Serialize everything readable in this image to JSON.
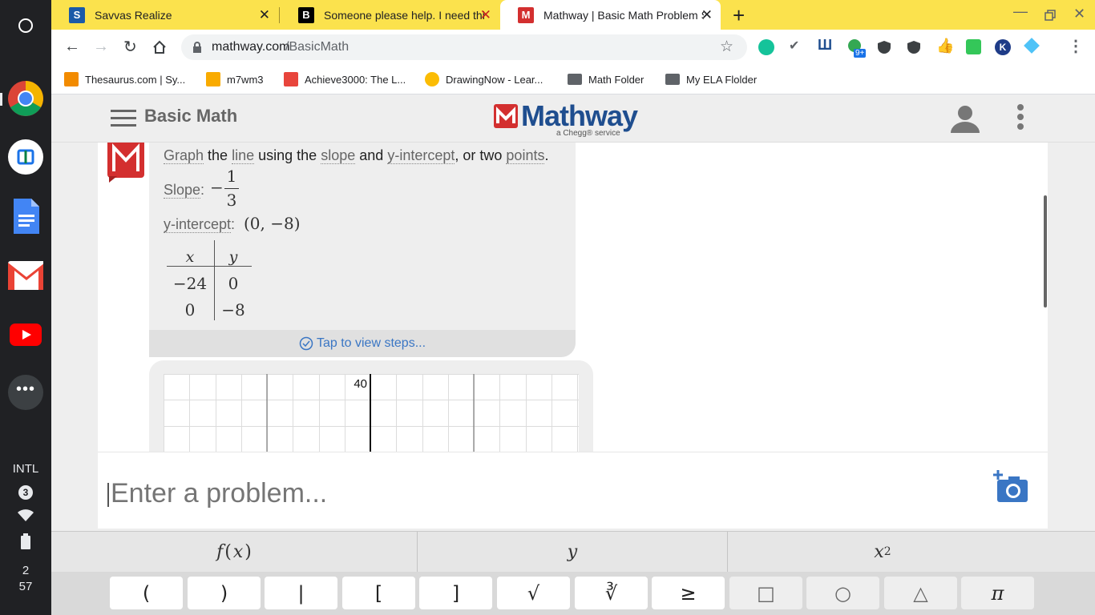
{
  "shelf": {
    "intl": "INTL",
    "notification_count": "3",
    "time_hour": "2",
    "time_minute": "57"
  },
  "tabs": [
    {
      "title": "Savvas Realize",
      "favicon": "S"
    },
    {
      "title": "Someone please help. I need this",
      "favicon": "B"
    },
    {
      "title": "Mathway | Basic Math Problem Solver",
      "favicon": "M"
    }
  ],
  "address": {
    "domain": "mathway.com",
    "path": "/BasicMath"
  },
  "extensions_badge": "9+",
  "ext_k": "K",
  "bookmarks": [
    {
      "label": "Thesaurus.com | Sy..."
    },
    {
      "label": "m7wm3"
    },
    {
      "label": "Achieve3000: The L..."
    },
    {
      "label": "DrawingNow - Lear..."
    },
    {
      "label": "Math Folder"
    },
    {
      "label": "My ELA Flolder"
    }
  ],
  "header": {
    "section": "Basic Math",
    "logo": "Mathway",
    "tagline": "a Chegg® service"
  },
  "answer": {
    "w_graph": "Graph",
    "w_the": "the",
    "w_line": "line",
    "w_using": "using the",
    "w_slope": "slope",
    "w_and": "and",
    "w_yint": "y-intercept",
    "w_or": ", or two",
    "w_points": "points",
    "w_period": ".",
    "slope_label": "Slope",
    "slope_sign": "−",
    "slope_num": "1",
    "slope_den": "3",
    "yint_label": "y-intercept",
    "yint_value": "(0, −8)",
    "colon": ":",
    "table_headers": [
      "x",
      "y"
    ],
    "table_rows": [
      [
        "−24",
        "0"
      ],
      [
        "0",
        "−8"
      ]
    ],
    "steps_label": "Tap to view steps..."
  },
  "graph": {
    "y_tick_label": "40"
  },
  "input": {
    "placeholder": "Enter a problem..."
  },
  "keypad": {
    "tabs": {
      "f": "f",
      "x": "x",
      "y": "y",
      "x2_base": "x",
      "x2_exp": "2"
    },
    "keys": [
      "(",
      ")",
      "|",
      "[",
      "]",
      "√",
      "∛",
      "≥",
      "□",
      "○",
      "△",
      "π"
    ]
  },
  "colors": {
    "tabstrip": "#fbe24d",
    "mathway_red": "#d32f2f",
    "mathway_blue": "#1f4e8f",
    "link_blue": "#3a76c4"
  }
}
